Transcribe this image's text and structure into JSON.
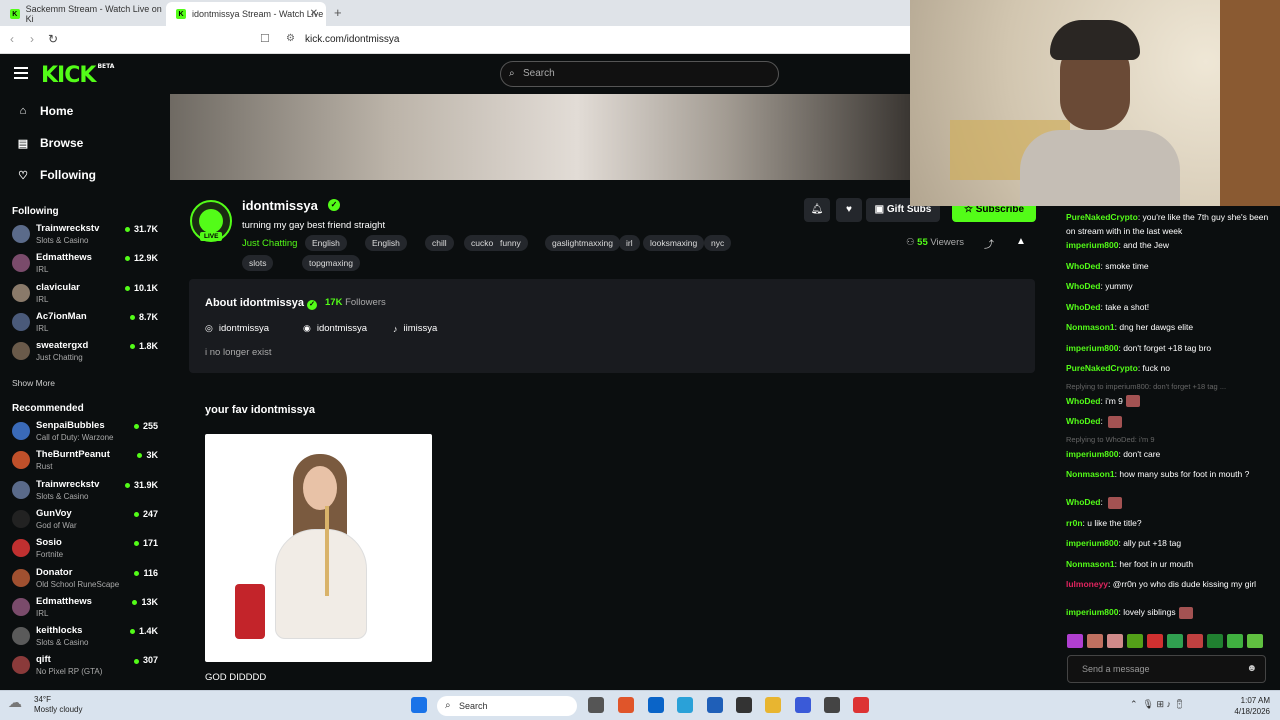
{
  "browser": {
    "tabs": [
      {
        "label": "Sackemm Stream - Watch Live on Ki"
      },
      {
        "label": "idontmissya Stream - Watch Live"
      }
    ],
    "new_tab": "+",
    "url": "kick.com/idontmissya"
  },
  "topbar": {
    "logo": "KICK",
    "logo_badge": "BETA",
    "search_placeholder": "Search"
  },
  "sidebar": {
    "nav": [
      {
        "label": "Home",
        "icon": "home-icon"
      },
      {
        "label": "Browse",
        "icon": "browse-icon"
      },
      {
        "label": "Following",
        "icon": "heart-icon"
      }
    ],
    "following_title": "Following",
    "following": [
      {
        "name": "Trainwreckstv",
        "category": "Slots & Casino",
        "viewers": "31.7K"
      },
      {
        "name": "Edmatthews",
        "category": "IRL",
        "viewers": "12.9K"
      },
      {
        "name": "clavicular",
        "category": "IRL",
        "viewers": "10.1K"
      },
      {
        "name": "Ac7ionMan",
        "category": "IRL",
        "viewers": "8.7K"
      },
      {
        "name": "sweatergxd",
        "category": "Just Chatting",
        "viewers": "1.8K"
      }
    ],
    "show_more": "Show More",
    "recommended_title": "Recommended",
    "recommended": [
      {
        "name": "SenpaiBubbles",
        "category": "Call of Duty: Warzone",
        "viewers": "255"
      },
      {
        "name": "TheBurntPeanut",
        "category": "Rust",
        "viewers": "3K"
      },
      {
        "name": "Trainwreckstv",
        "category": "Slots & Casino",
        "viewers": "31.9K"
      },
      {
        "name": "GunVoy",
        "category": "God of War",
        "viewers": "247"
      },
      {
        "name": "Sosio",
        "category": "Fortnite",
        "viewers": "171"
      },
      {
        "name": "Donator",
        "category": "Old School RuneScape",
        "viewers": "116"
      },
      {
        "name": "Edmatthews",
        "category": "IRL",
        "viewers": "13K"
      },
      {
        "name": "keithlocks",
        "category": "Slots & Casino",
        "viewers": "1.4K"
      },
      {
        "name": "qift",
        "category": "No Pixel RP (GTA)",
        "viewers": "307"
      }
    ]
  },
  "channel": {
    "username": "idontmissya",
    "live_badge": "LIVE",
    "stream_title": "turning my gay best friend straight",
    "category": "Just Chatting",
    "tags": [
      "English",
      "English",
      "chill",
      "cuckold",
      "funny",
      "gaslightmaxxing",
      "irl",
      "looksmaxing",
      "nyc",
      "slots",
      "topgmaxing"
    ],
    "gift_subs": "Gift Subs",
    "subscribe": "Subscribe",
    "viewers_count": "55",
    "viewers_label": "Viewers"
  },
  "about": {
    "title": "About idontmissya",
    "followers_count": "17K",
    "followers_label": "Followers",
    "socials": [
      {
        "label": "idontmissya",
        "icon": "instagram-icon"
      },
      {
        "label": "idontmissya",
        "icon": "discord-icon"
      },
      {
        "label": "iimissya",
        "icon": "tiktok-icon"
      }
    ],
    "bio": "i no longer exist"
  },
  "favorites": {
    "title": "your fav idontmissya",
    "caption": "GOD DIDDDD"
  },
  "chat": {
    "messages": [
      {
        "user": "PureNakedCrypto",
        "color": "#53fc18",
        "text": "you're like the 7th guy she's been on stream with in the last week"
      },
      {
        "user": "imperium800",
        "color": "#53fc18",
        "text": "and the Jew"
      },
      {
        "user": "WhoDed",
        "color": "#53fc18",
        "text": "smoke time"
      },
      {
        "user": "WhoDed",
        "color": "#53fc18",
        "text": "yummy"
      },
      {
        "user": "WhoDed",
        "color": "#53fc18",
        "text": "take a shot!"
      },
      {
        "user": "Nonmason1",
        "color": "#53fc18",
        "text": "dng her dawgs elite"
      },
      {
        "user": "imperium800",
        "color": "#53fc18",
        "text": "don't forget +18 tag bro"
      },
      {
        "user": "PureNakedCrypto",
        "color": "#53fc18",
        "text": "fuck no"
      },
      {
        "reply": "Replying to imperium800: don't forget +18 tag ..."
      },
      {
        "user": "WhoDed",
        "color": "#53fc18",
        "text": "i'm 9"
      },
      {
        "user": "WhoDed",
        "color": "#53fc18",
        "text": ""
      },
      {
        "reply": "Replying to WhoDed: i'm 9"
      },
      {
        "user": "imperium800",
        "color": "#53fc18",
        "text": "don't care"
      },
      {
        "user": "Nonmason1",
        "color": "#53fc18",
        "text": "how many subs for foot in mouth ?"
      },
      {
        "user": "WhoDed",
        "color": "#53fc18",
        "text": ""
      },
      {
        "user": "rr0n",
        "color": "#53fc18",
        "text": "u like the title?"
      },
      {
        "user": "imperium800",
        "color": "#53fc18",
        "text": "ally put +18 tag"
      },
      {
        "user": "Nonmason1",
        "color": "#53fc18",
        "text": "her foot in ur mouth"
      },
      {
        "user": "lulmoneyy",
        "color": "#e0245e",
        "text": "@rr0n yo who dis dude kissing my girl"
      },
      {
        "user": "imperium800",
        "color": "#53fc18",
        "text": "lovely siblings"
      }
    ],
    "input_placeholder": "Send a message"
  },
  "taskbar": {
    "weather_temp": "34°F",
    "weather_desc": "Mostly cloudy",
    "search": "Search",
    "time": "1:07 AM",
    "date": "4/18/2026"
  },
  "colors": {
    "accent": "#53fc18",
    "bg": "#0b0e0f",
    "panel": "#191b1f"
  }
}
